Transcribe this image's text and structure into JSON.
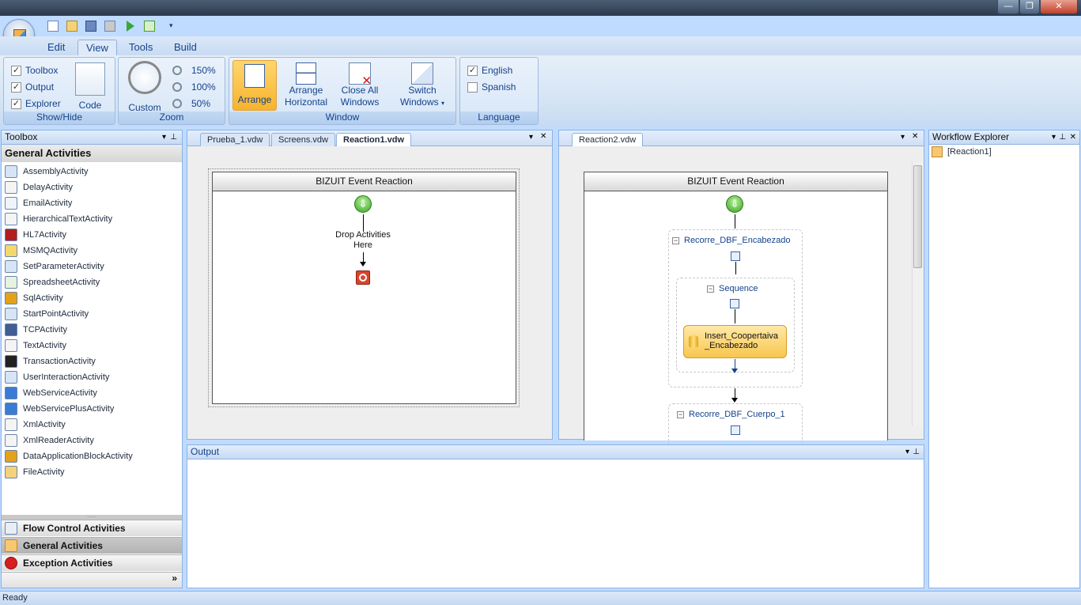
{
  "window": {
    "minimize": "—",
    "maximize": "❐",
    "close": "✕"
  },
  "ribbon_tabs": [
    "Edit",
    "View",
    "Tools",
    "Build"
  ],
  "ribbon": {
    "show_hide": {
      "label": "Show/Hide",
      "items": [
        {
          "label": "Toolbox",
          "checked": true
        },
        {
          "label": "Output",
          "checked": true
        },
        {
          "label": "Explorer",
          "checked": true
        }
      ],
      "code": "Code"
    },
    "zoom": {
      "label": "Zoom",
      "custom": "Custom",
      "levels": [
        "150%",
        "100%",
        "50%"
      ]
    },
    "window": {
      "label": "Window",
      "arrange": "Arrange",
      "arrange_horizontal_1": "Arrange",
      "arrange_horizontal_2": "Horizontal",
      "close_all_1": "Close All",
      "close_all_2": "Windows",
      "switch_1": "Switch",
      "switch_2": "Windows"
    },
    "language": {
      "label": "Language",
      "items": [
        {
          "label": "English",
          "checked": true
        },
        {
          "label": "Spanish",
          "checked": false
        }
      ]
    }
  },
  "toolbox": {
    "title": "Toolbox",
    "section": "General Activities",
    "items": [
      "AssemblyActivity",
      "DelayActivity",
      "EmailActivity",
      "HierarchicalTextActivity",
      "HL7Activity",
      "MSMQActivity",
      "SetParameterActivity",
      "SpreadsheetActivity",
      "SqlActivity",
      "StartPointActivity",
      "TCPActivity",
      "TextActivity",
      "TransactionActivity",
      "UserInteractionActivity",
      "WebServiceActivity",
      "WebServicePlusActivity",
      "XmlActivity",
      "XmlReaderActivity",
      "DataApplicationBlockActivity",
      "FileActivity"
    ],
    "categories": [
      "Flow Control Activities",
      "General Activities",
      "Exception Activities"
    ],
    "more": "»"
  },
  "doc1": {
    "tabs": [
      "Prueba_1.vdw",
      "Screens.vdw",
      "Reaction1.vdw"
    ],
    "header": "BIZUIT Event Reaction",
    "drop_1": "Drop Activities",
    "drop_2": "Here"
  },
  "doc2": {
    "tabs": [
      "Reaction2.vdw"
    ],
    "header": "BIZUIT Event Reaction",
    "scope1": "Recorre_DBF_Encabezado",
    "seq": "Sequence",
    "activity_1": "Insert_Coopertaiva",
    "activity_2": "_Encabezado",
    "scope2": "Recorre_DBF_Cuerpo_1"
  },
  "output": {
    "title": "Output"
  },
  "explorer": {
    "title": "Workflow Explorer",
    "node": "[Reaction1]"
  },
  "status": "Ready",
  "glyphs": {
    "dropdown": "▾",
    "pin": "⊥",
    "close": "✕",
    "arrow_down": "⇩"
  }
}
